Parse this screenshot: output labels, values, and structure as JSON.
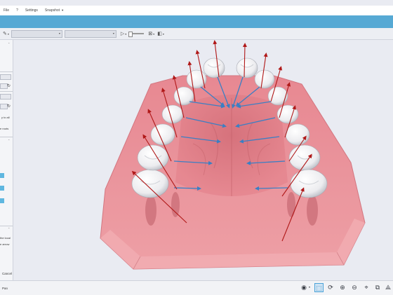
{
  "menu": {
    "file": "File",
    "help": "?",
    "settings": "Settings",
    "snapshot": "Snapshot"
  },
  "toolbar": {
    "pen_icon": "pen-icon",
    "play_icon": "play-icon"
  },
  "left_panel": {
    "text_apply_all": "y to all",
    "text_roots": "e roots",
    "text_local": "the local",
    "text_arrow": "e arrow",
    "cancel": "Cancel"
  },
  "status": {
    "mode": "Pan"
  },
  "colors": {
    "accent": "#56a9d4",
    "gum": "#e8878d",
    "tooth": "#f4f4f6",
    "arrow_red": "#b01818",
    "arrow_blue": "#3a7fc4"
  }
}
